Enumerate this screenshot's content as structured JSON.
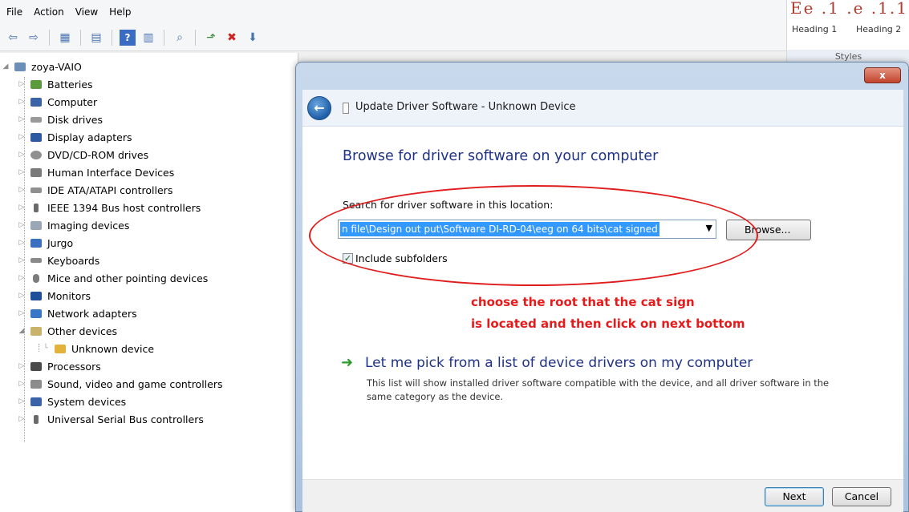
{
  "menu": [
    "File",
    "Action",
    "View",
    "Help"
  ],
  "toolbar_icons": [
    "back-icon",
    "forward-icon",
    "properties-icon",
    "list-icon",
    "help-icon",
    "view-icon",
    "scan-icon",
    "update-driver-icon",
    "uninstall-icon",
    "disable-icon"
  ],
  "tree": {
    "root": "zoya-VAIO",
    "items": [
      "Batteries",
      "Computer",
      "Disk drives",
      "Display adapters",
      "DVD/CD-ROM drives",
      "Human Interface Devices",
      "IDE ATA/ATAPI controllers",
      "IEEE 1394 Bus host controllers",
      "Imaging devices",
      "Jurgo",
      "Keyboards",
      "Mice and other pointing devices",
      "Monitors",
      "Network adapters",
      "Other devices",
      "Unknown device",
      "Processors",
      "Sound, video and game controllers",
      "System devices",
      "Universal Serial Bus controllers"
    ]
  },
  "ribbon": {
    "heading1": "Heading 1",
    "heading2": "Heading 2",
    "styles": "Styles"
  },
  "dialog": {
    "close": "x",
    "title": "Update Driver Software - Unknown Device",
    "heading": "Browse for driver software on your computer",
    "location_label": "Search for driver software in this location:",
    "location_value": "n file\\Design out put\\Software DI-RD-04\\eeg on 64 bits\\cat signed",
    "browse_label": "Browse...",
    "include_subfolders_label": "Include subfolders",
    "include_subfolders_checked": true,
    "annotation_line1": "choose the root that the cat sign",
    "annotation_line2": "is located and then click on next bottom",
    "pick_link": "Let me pick from a list of device drivers on my computer",
    "pick_desc": "This list will show installed driver software compatible with the device, and all driver software in the same category as the device.",
    "next_label": "Next",
    "cancel_label": "Cancel"
  },
  "colors": {
    "accent_blue": "#1e3287",
    "annotation_red": "#e51b1b",
    "selection_blue": "#3399ff"
  }
}
